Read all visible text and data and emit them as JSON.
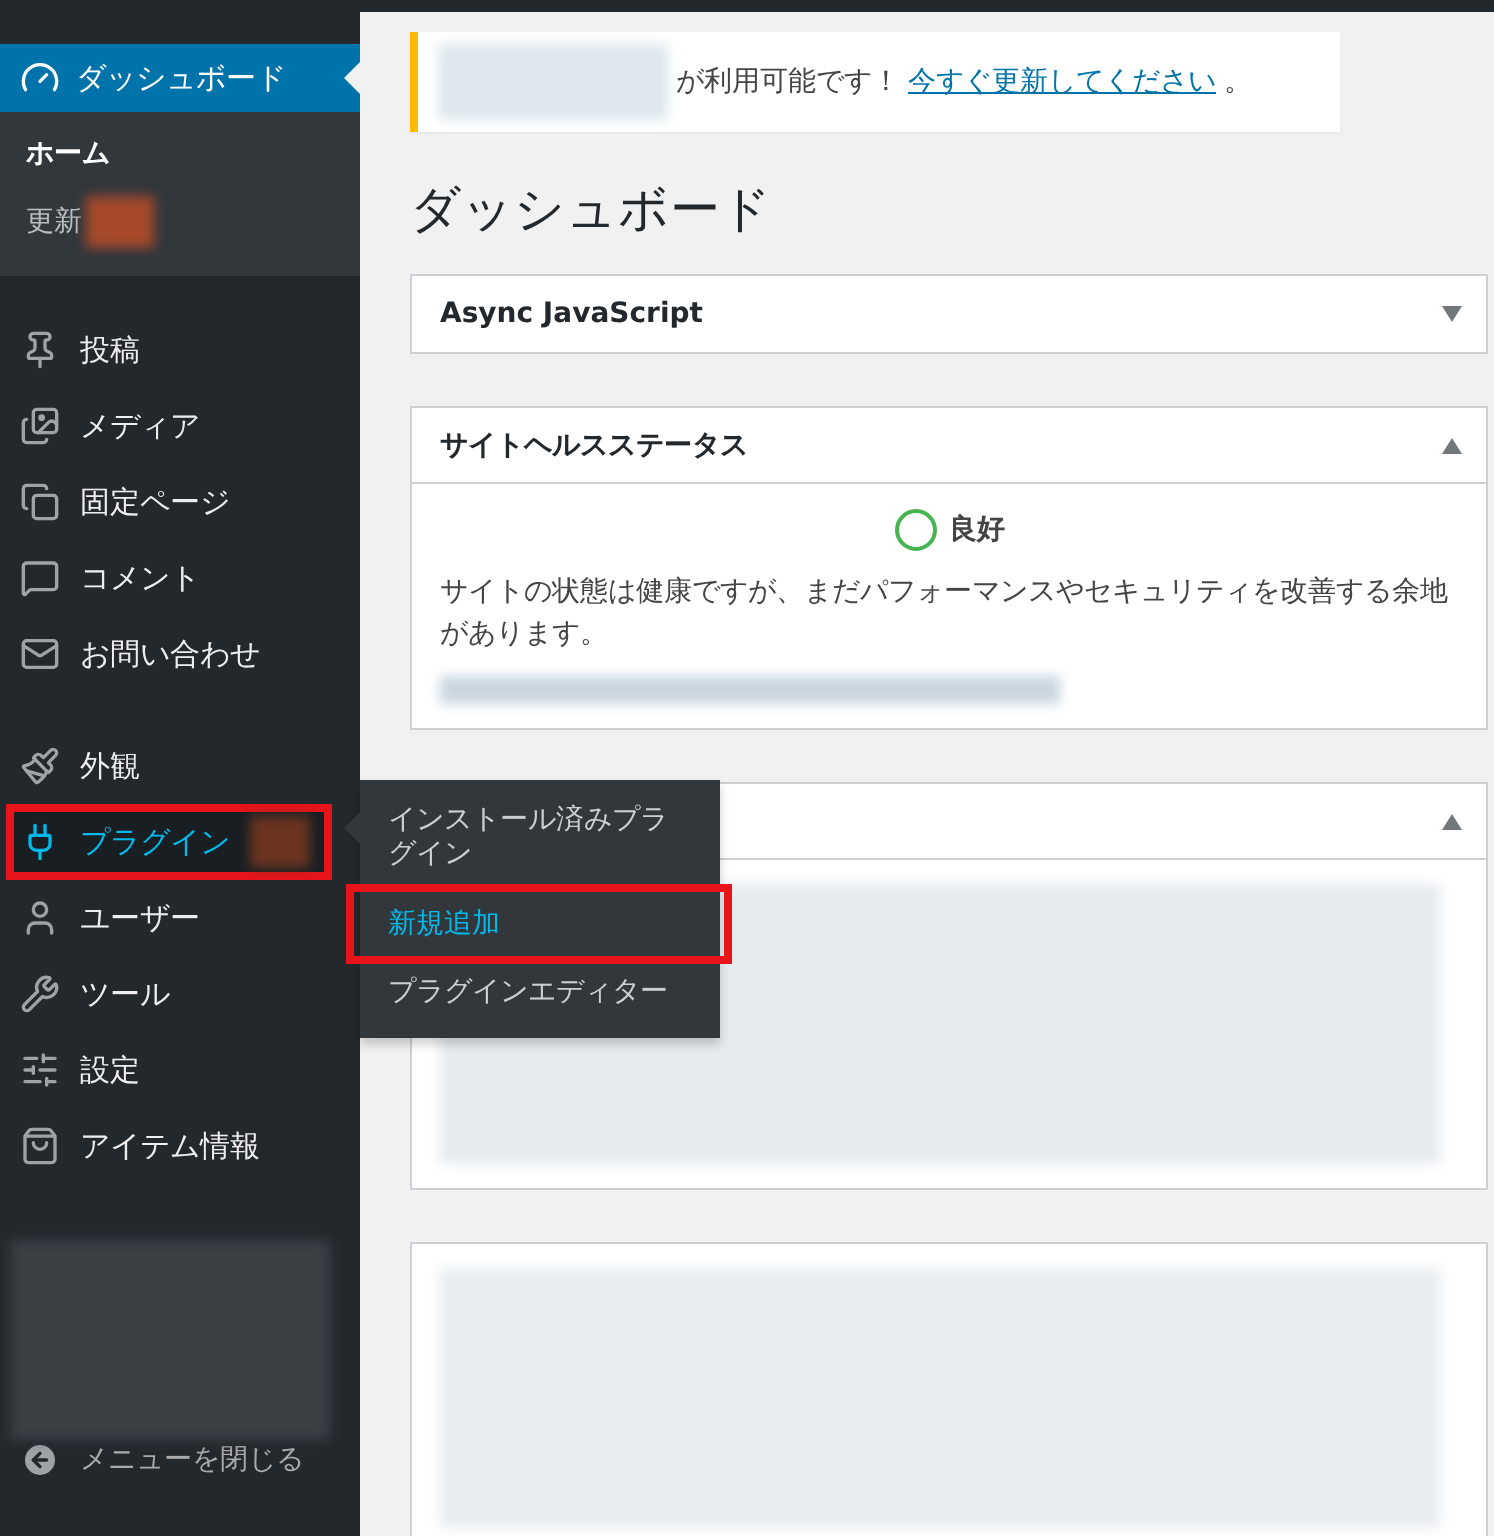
{
  "sidebar": {
    "dashboard": {
      "label": "ダッシュボード",
      "selected": true
    },
    "submenu": [
      {
        "label": "ホーム",
        "selected": true,
        "badge": false
      },
      {
        "label": "更新",
        "selected": false,
        "badge": true
      }
    ],
    "groups": [
      [
        {
          "label": "投稿",
          "selected": false,
          "highlighted": false,
          "badge": false
        },
        {
          "label": "メディア",
          "selected": false,
          "highlighted": false,
          "badge": false
        },
        {
          "label": "固定ページ",
          "selected": false,
          "highlighted": false,
          "badge": false
        },
        {
          "label": "コメント",
          "selected": false,
          "highlighted": false,
          "badge": false
        },
        {
          "label": "お問い合わせ",
          "selected": false,
          "highlighted": false,
          "badge": false
        }
      ],
      [
        {
          "label": "外観",
          "selected": false,
          "highlighted": false,
          "badge": false
        },
        {
          "label": "プラグイン",
          "selected": true,
          "highlighted": true,
          "badge": true
        },
        {
          "label": "ユーザー",
          "selected": false,
          "highlighted": false,
          "badge": false
        },
        {
          "label": "ツール",
          "selected": false,
          "highlighted": false,
          "badge": false
        },
        {
          "label": "設定",
          "selected": false,
          "highlighted": false,
          "badge": false
        },
        {
          "label": "アイテム情報",
          "selected": false,
          "highlighted": false,
          "badge": false
        }
      ]
    ],
    "collapse": "メニューを閉じる"
  },
  "flyout": [
    {
      "label": "インストール済みプラグイン",
      "selected": false,
      "highlighted": false
    },
    {
      "label": "新規追加",
      "selected": true,
      "highlighted": true
    },
    {
      "label": "プラグインエディター",
      "selected": false,
      "highlighted": false
    }
  ],
  "notice": {
    "text": "が利用可能です！",
    "link": "今すぐ更新してください",
    "end": "。"
  },
  "title": "ダッシュボード",
  "widgets": [
    {
      "kind": "plain",
      "title": "Async JavaScript",
      "expanded": false
    },
    {
      "kind": "health",
      "title": "サイトヘルスステータス",
      "expanded": true,
      "status": "良好",
      "text": "サイトの状態は健康ですが、まだパフォーマンスやセキュリティを改善する余地があります。"
    },
    {
      "kind": "hidden",
      "expanded": true
    },
    {
      "kind": "blurred",
      "expanded": true
    }
  ]
}
